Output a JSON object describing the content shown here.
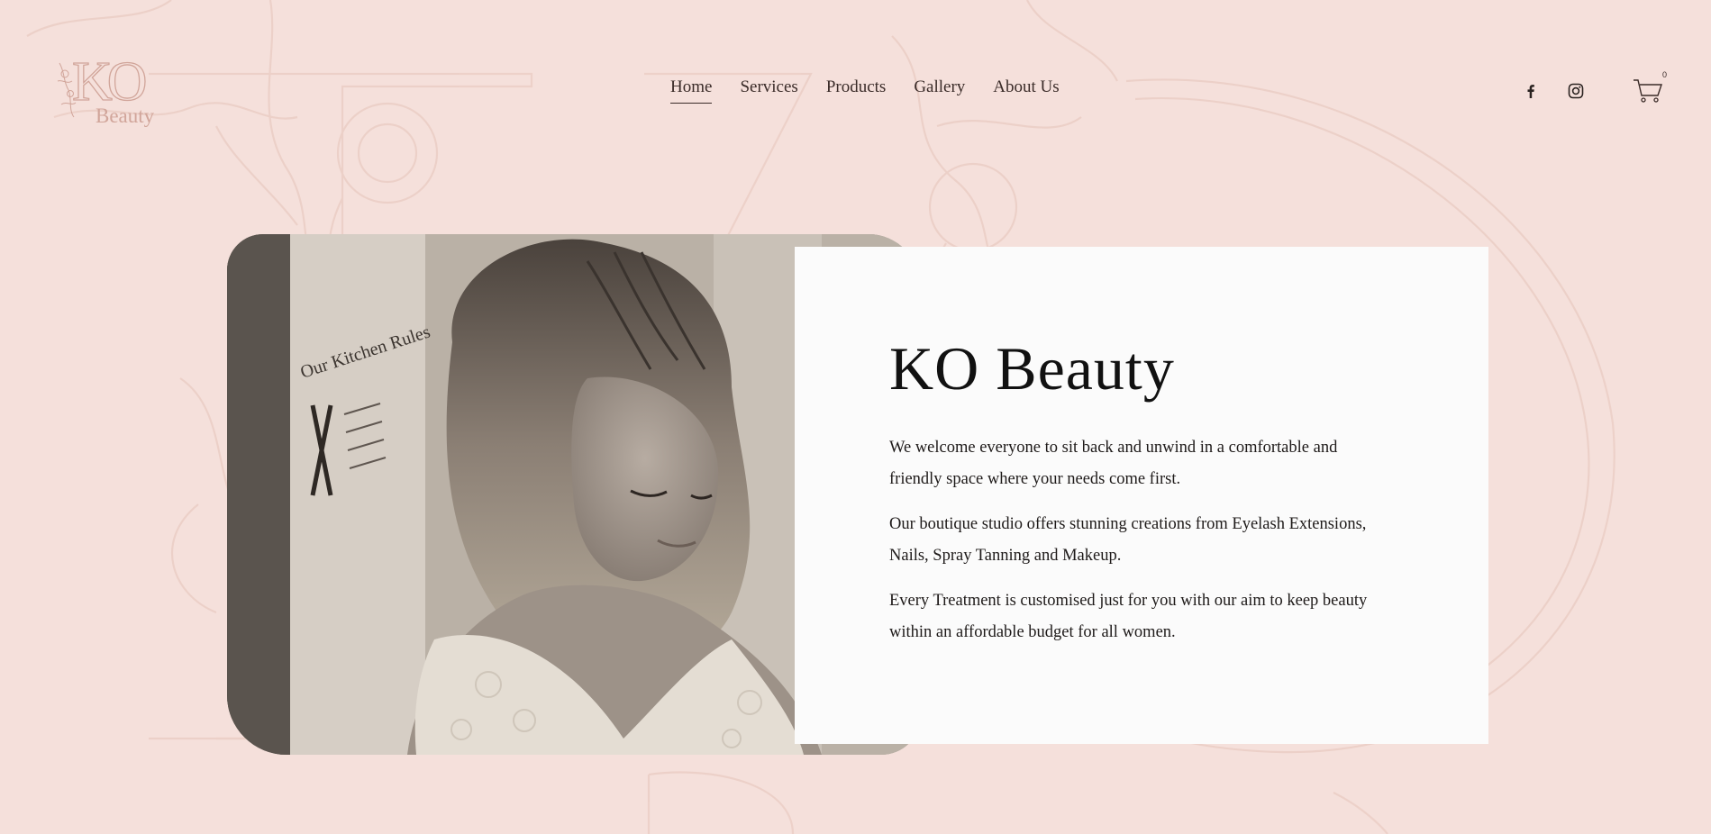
{
  "brand": {
    "logo_letters": "KO",
    "logo_word": "Beauty",
    "accent_color": "#d1a59a",
    "background_color": "#f5e0db"
  },
  "nav": {
    "items": [
      {
        "label": "Home",
        "active": true
      },
      {
        "label": "Services",
        "active": false
      },
      {
        "label": "Products",
        "active": false
      },
      {
        "label": "Gallery",
        "active": false
      },
      {
        "label": "About Us",
        "active": false
      }
    ]
  },
  "social": {
    "facebook_icon": "facebook-icon",
    "instagram_icon": "instagram-icon"
  },
  "cart": {
    "icon": "cart-icon",
    "count": "0"
  },
  "hero": {
    "title": "KO Beauty",
    "paragraphs": [
      "We welcome everyone to sit back and unwind in a comfortable and friendly space where your needs come first.",
      "Our boutique studio offers stunning creations from Eyelash Extensions, Nails, Spray Tanning and Makeup.",
      "Every Treatment is customised just for you with our aim to keep beauty within an affordable budget for all women."
    ],
    "photo_description_icon": "hero-photo",
    "photo_sign_text": "Our Kitchen Rules"
  }
}
